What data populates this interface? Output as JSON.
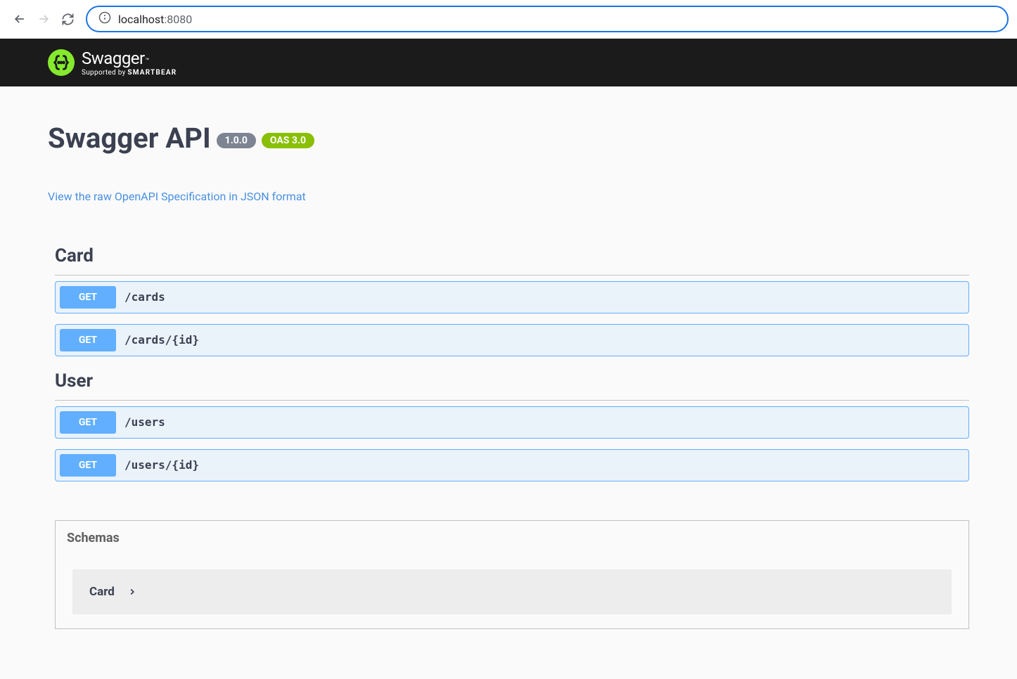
{
  "browser": {
    "url_host": "localhost",
    "url_port": ":8080"
  },
  "header": {
    "logo_text": "Swagger",
    "logo_subtitle_prefix": "Supported by ",
    "logo_subtitle_brand": "SMARTBEAR"
  },
  "api": {
    "title": "Swagger API",
    "version": "1.0.0",
    "oas": "OAS 3.0",
    "spec_link": "View the raw OpenAPI Specification in JSON format"
  },
  "tags": [
    {
      "name": "Card",
      "operations": [
        {
          "method": "GET",
          "path": "/cards"
        },
        {
          "method": "GET",
          "path": "/cards/{id}"
        }
      ]
    },
    {
      "name": "User",
      "operations": [
        {
          "method": "GET",
          "path": "/users"
        },
        {
          "method": "GET",
          "path": "/users/{id}"
        }
      ]
    }
  ],
  "schemas": {
    "title": "Schemas",
    "items": [
      {
        "name": "Card"
      }
    ]
  },
  "colors": {
    "get_bg": "#61affe",
    "swagger_green": "#85ea2d",
    "oas_green": "#89bf04",
    "text_dark": "#3b4151",
    "link_blue": "#4990e2"
  }
}
